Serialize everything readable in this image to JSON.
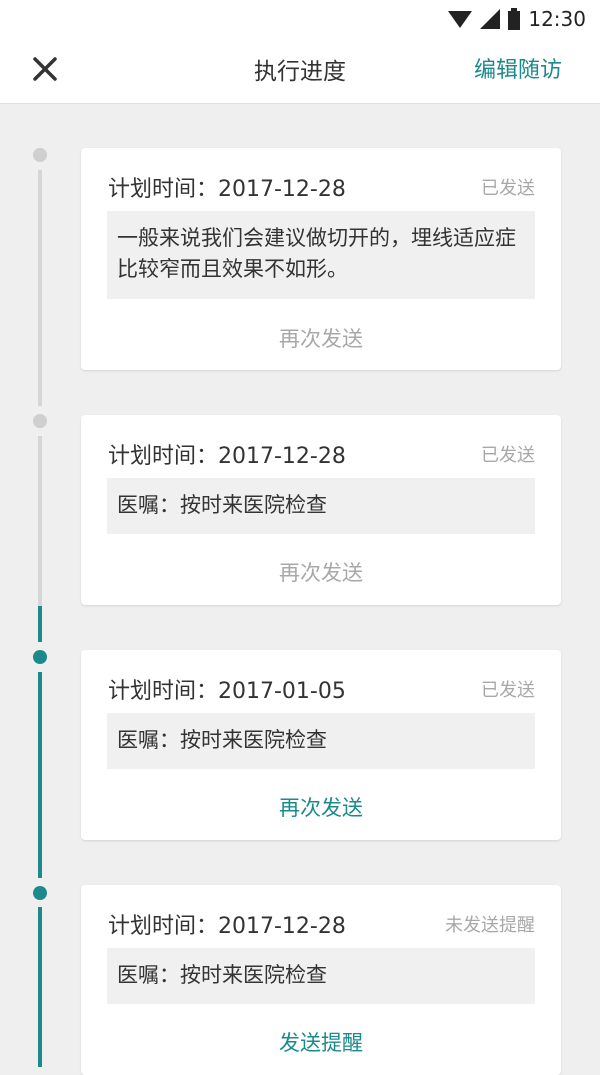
{
  "status_bar": {
    "time": "12:30"
  },
  "header": {
    "title": "执行进度",
    "edit_label": "编辑随访"
  },
  "colors": {
    "accent": "#1c8a8a",
    "inactive": "#cfcfcf",
    "muted": "#a8a8a8"
  },
  "items": [
    {
      "plan": "计划时间：2017-12-28",
      "status": "已发送",
      "content": "一般来说我们会建议做切开的，埋线适应症比较窄而且效果不如形。",
      "action": "再次发送",
      "active": false
    },
    {
      "plan": "计划时间：2017-12-28",
      "status": "已发送",
      "content": "医嘱：按时来医院检查",
      "action": "再次发送",
      "active": false
    },
    {
      "plan": "计划时间：2017-01-05",
      "status": "已发送",
      "content": "医嘱：按时来医院检查",
      "action": "再次发送",
      "active": true
    },
    {
      "plan": "计划时间：2017-12-28",
      "status": "未发送提醒",
      "content": "医嘱：按时来医院检查",
      "action": "发送提醒",
      "active": true
    }
  ]
}
